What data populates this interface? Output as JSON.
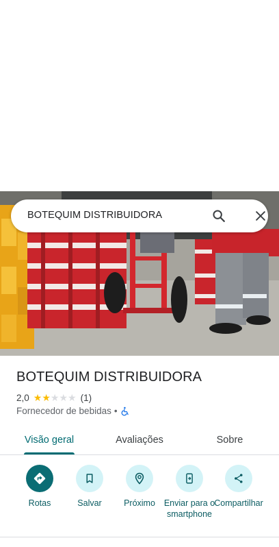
{
  "search": {
    "query": "BOTEQUIM DISTRIBUIDORA",
    "search_icon": "search-icon",
    "close_icon": "close-icon"
  },
  "place": {
    "photo_icon": "storefront-photo",
    "title": "BOTEQUIM DISTRIBUIDORA",
    "rating_value": "2,0",
    "rating_stars": 2,
    "rating_max": 5,
    "review_count": "(1)",
    "category": "Fornecedor de bebidas",
    "separator": "•",
    "accessibility_icon": "wheelchair-icon"
  },
  "tabs": [
    {
      "label": "Visão geral",
      "active": true
    },
    {
      "label": "Avaliações",
      "active": false
    },
    {
      "label": "Sobre",
      "active": false
    }
  ],
  "actions": [
    {
      "label": "Rotas",
      "icon": "directions-icon"
    },
    {
      "label": "Salvar",
      "icon": "bookmark-icon"
    },
    {
      "label": "Próximo",
      "icon": "nearby-icon"
    },
    {
      "label": "Enviar para o smartphone",
      "icon": "send-to-phone-icon"
    },
    {
      "label": "Compartilhar",
      "icon": "share-icon"
    }
  ],
  "colors": {
    "accent": "#006b72",
    "star": "#fbbc04",
    "action_bg": "#d3f3f7"
  }
}
